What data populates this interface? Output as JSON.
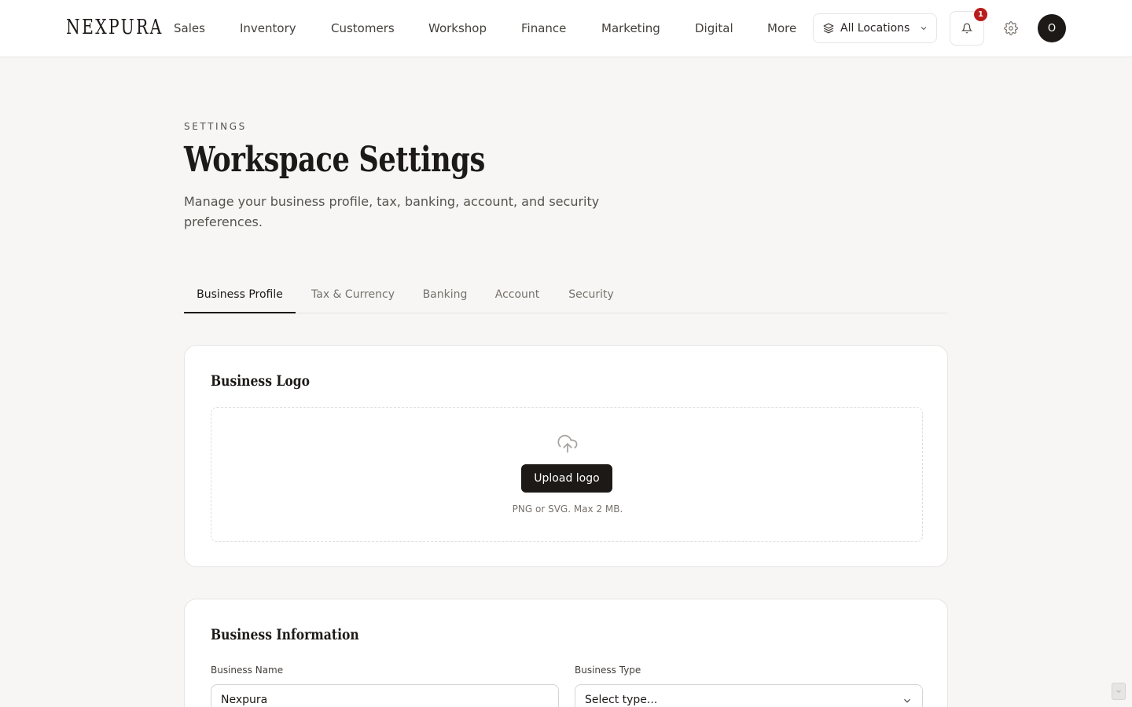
{
  "brand": {
    "name": "NEXPURA"
  },
  "nav": {
    "items": [
      {
        "label": "Sales"
      },
      {
        "label": "Inventory"
      },
      {
        "label": "Customers"
      },
      {
        "label": "Workshop"
      },
      {
        "label": "Finance"
      },
      {
        "label": "Marketing"
      },
      {
        "label": "Digital"
      },
      {
        "label": "More"
      }
    ]
  },
  "topbar": {
    "location_label": "All Locations",
    "location_icon": "layers-icon",
    "notification_count": "1",
    "avatar_initial": "O"
  },
  "header": {
    "eyebrow": "SETTINGS",
    "title": "Workspace Settings",
    "description": "Manage your business profile, tax, banking, account, and security preferences."
  },
  "tabs": [
    {
      "label": "Business Profile",
      "active": true
    },
    {
      "label": "Tax & Currency",
      "active": false
    },
    {
      "label": "Banking",
      "active": false
    },
    {
      "label": "Account",
      "active": false
    },
    {
      "label": "Security",
      "active": false
    }
  ],
  "logo_card": {
    "title": "Business Logo",
    "upload_label": "Upload logo",
    "hint": "PNG or SVG. Max 2 MB."
  },
  "info_card": {
    "title": "Business Information",
    "business_name_label": "Business Name",
    "business_name_value": "Nexpura",
    "business_type_label": "Business Type",
    "business_type_placeholder": "Select type..."
  },
  "colors": {
    "background": "#f7f6f4",
    "primary": "#1c1917",
    "badge": "#b91c1c",
    "border": "#e7e5e4"
  }
}
